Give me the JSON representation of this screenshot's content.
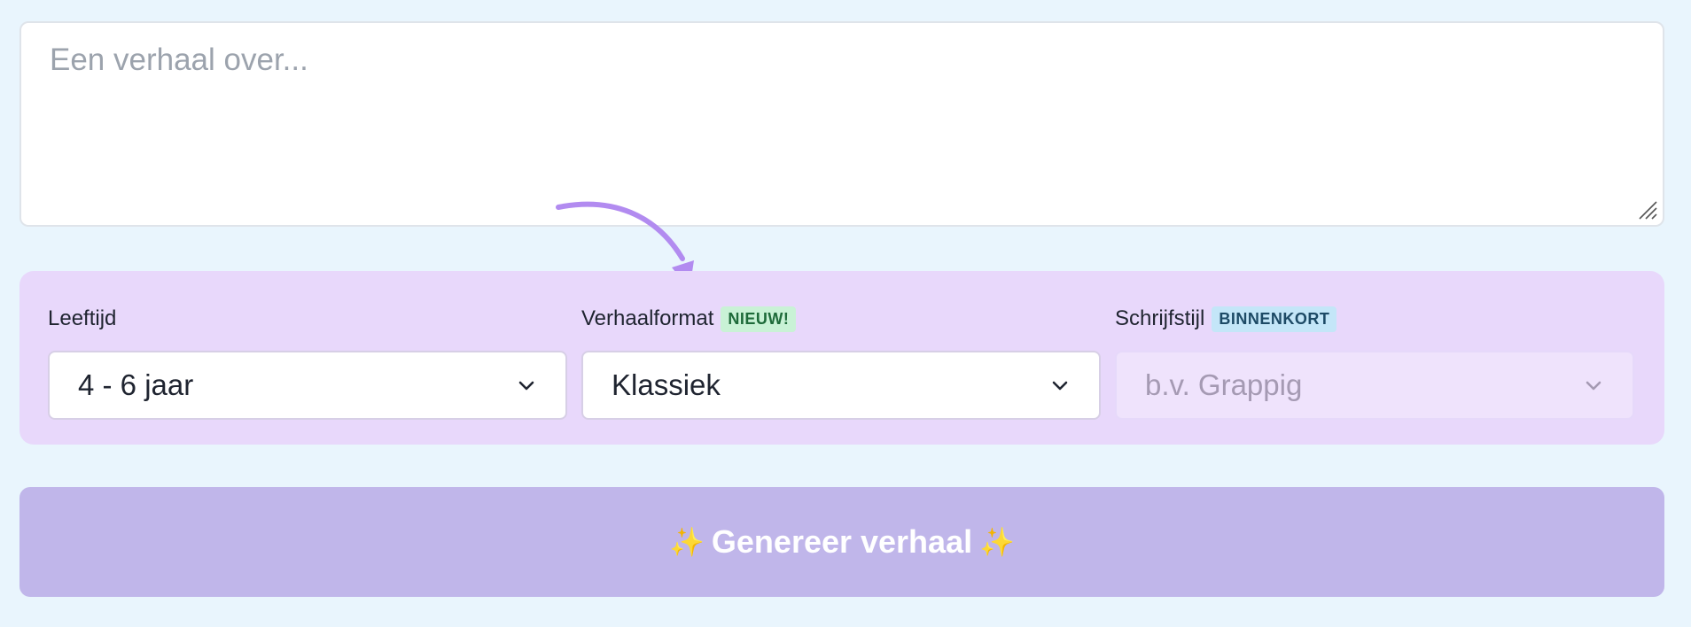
{
  "story": {
    "placeholder": "Een verhaal over...",
    "value": ""
  },
  "options": {
    "age": {
      "label": "Leeftijd",
      "selected": "4 - 6 jaar"
    },
    "format": {
      "label": "Verhaalformat",
      "badge": "NIEUW!",
      "selected": "Klassiek"
    },
    "style": {
      "label": "Schrijfstijl",
      "badge": "BINNENKORT",
      "placeholder": "b.v. Grappig",
      "disabled": true
    }
  },
  "generate_button": {
    "label": "Genereer verhaal",
    "sparkle_left": "✨",
    "sparkle_right": "✨"
  },
  "icons": {
    "select_arrow": "chevron-down-icon",
    "hint_arrow": "curved-arrow-icon",
    "resize": "resize-handle-icon"
  },
  "colors": {
    "page_background": "#e9f5fd",
    "panel_background": "#e8d8fb",
    "button_background": "#c0b6ea",
    "arrow": "#b28bf0",
    "badge_new": "#c9f2d6",
    "badge_soon": "#c4e6f8"
  }
}
